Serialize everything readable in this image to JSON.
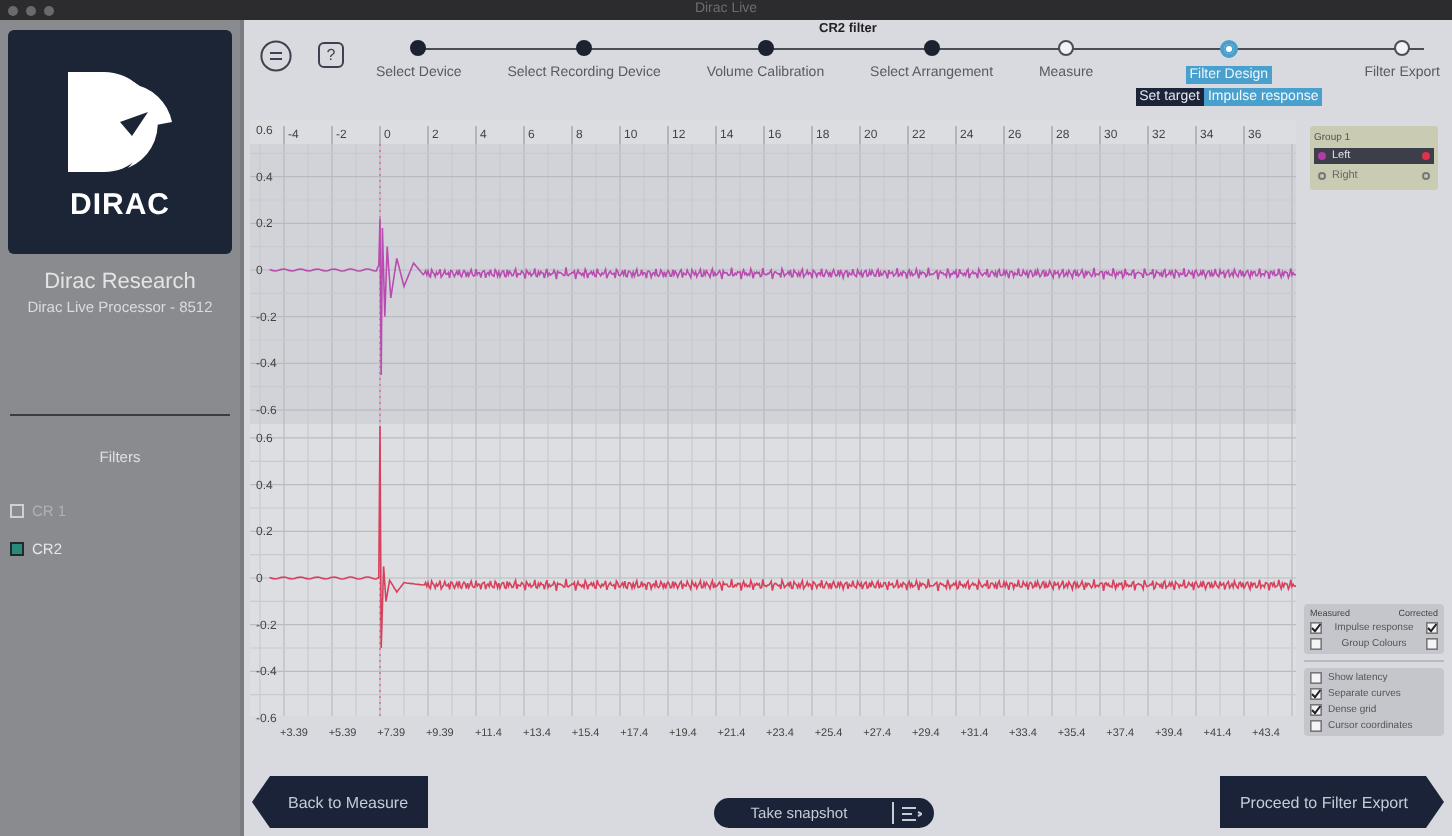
{
  "window": {
    "title": "Dirac Live"
  },
  "sidebar": {
    "logo_text": "DIRAC",
    "company": "Dirac Research",
    "device": "Dirac Live Processor - 8512",
    "filters_heading": "Filters",
    "filters": [
      {
        "label": "CR 1",
        "checked": false
      },
      {
        "label": "CR2",
        "checked": true
      }
    ]
  },
  "header": {
    "title": "CR2 filter",
    "help_button": "?"
  },
  "steps": [
    {
      "label": "Select Device",
      "completed": true,
      "selected": false
    },
    {
      "label": "Select Recording Device",
      "completed": true,
      "selected": false
    },
    {
      "label": "Volume Calibration",
      "completed": true,
      "selected": false
    },
    {
      "label": "Select Arrangement",
      "completed": true,
      "selected": false
    },
    {
      "label": "Measure",
      "completed": false,
      "selected": false
    },
    {
      "label": "Filter Design",
      "completed": false,
      "selected": true
    },
    {
      "label": "Filter Export",
      "completed": false,
      "selected": false
    }
  ],
  "subtabs": [
    {
      "label": "Set target",
      "selected": false
    },
    {
      "label": "Impulse response",
      "selected": true
    }
  ],
  "plot": {
    "x_ticks": [
      "-4",
      "-2",
      "0",
      "2",
      "4",
      "6",
      "8",
      "10",
      "12",
      "14",
      "16",
      "18",
      "20",
      "22",
      "24",
      "26",
      "28",
      "30",
      "32",
      "34",
      "36"
    ],
    "upper_y_ticks": [
      "0.6",
      "0.4",
      "0.2",
      "0",
      "-0.2",
      "-0.4",
      "-0.6"
    ],
    "lower_y_ticks": [
      "0.6",
      "0.4",
      "0.2",
      "0",
      "-0.2",
      "-0.4",
      "-0.6"
    ],
    "time_ticks": [
      "+3.39",
      "+5.39",
      "+7.39",
      "+9.39",
      "+11.4",
      "+13.4",
      "+15.4",
      "+17.4",
      "+19.4",
      "+21.4",
      "+23.4",
      "+25.4",
      "+27.4",
      "+29.4",
      "+31.4",
      "+33.4",
      "+35.4",
      "+37.4",
      "+39.4",
      "+41.4",
      "+43.4"
    ]
  },
  "group": {
    "title": "Group 1",
    "channels": [
      {
        "label": "Left",
        "selected": true,
        "color": "#b43aa8",
        "corrected_dot": {
          "color": "#e0304c"
        }
      },
      {
        "label": "Right",
        "selected": false
      }
    ]
  },
  "curves_panel": {
    "columns": [
      "Measured",
      "Corrected"
    ],
    "rows": [
      {
        "label": "Impulse response",
        "measured": true,
        "corrected": true
      },
      {
        "label": "Group Colours",
        "measured": false,
        "corrected": false
      }
    ]
  },
  "options": [
    {
      "label": "Show latency",
      "checked": false
    },
    {
      "label": "Separate curves",
      "checked": true
    },
    {
      "label": "Dense grid",
      "checked": true
    },
    {
      "label": "Cursor coordinates",
      "checked": false
    }
  ],
  "buttons": {
    "back": "Back to Measure",
    "snapshot": "Take snapshot",
    "proceed": "Proceed to Filter Export"
  }
}
